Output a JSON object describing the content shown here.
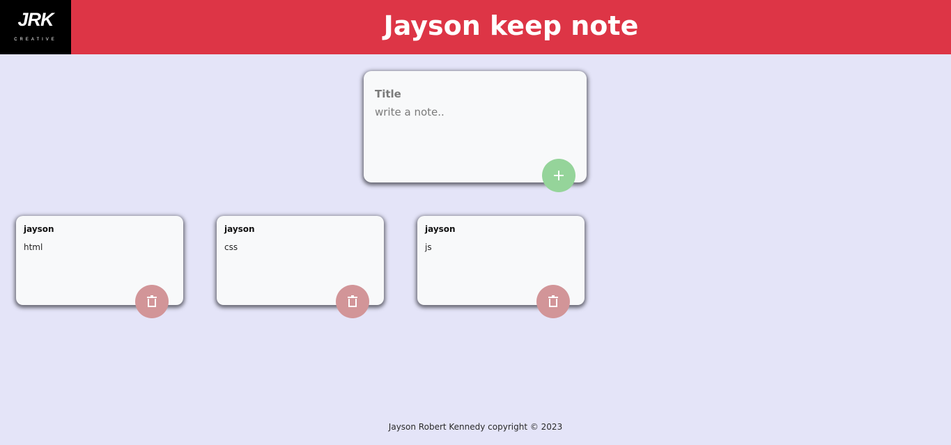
{
  "header": {
    "logo_text": "JRK",
    "logo_subtext": "CREATIVE",
    "title": "Jayson keep note"
  },
  "composer": {
    "title_placeholder": "Title",
    "title_value": "",
    "body_placeholder": "write a note..",
    "body_value": "",
    "add_icon": "plus-icon",
    "add_color": "#95d49a"
  },
  "notes": [
    {
      "title": "jayson",
      "content": "html"
    },
    {
      "title": "jayson",
      "content": "css"
    },
    {
      "title": "jayson",
      "content": "js"
    }
  ],
  "note_delete_icon": "trash-icon",
  "note_delete_color": "#d29598",
  "footer": {
    "text": "Jayson Robert Kennedy copyright © 2023"
  },
  "colors": {
    "header_bg": "#dd3546",
    "page_bg": "#e4e4f8",
    "card_bg": "#f8f9fa"
  }
}
